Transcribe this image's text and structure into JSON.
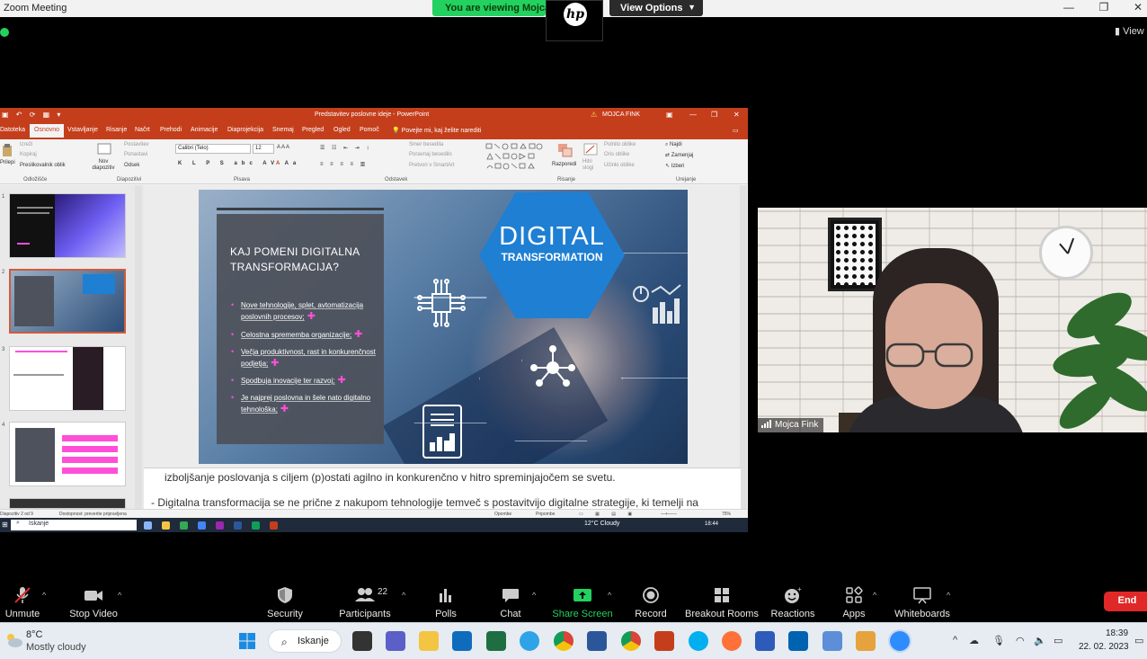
{
  "zoom": {
    "window_title": "Zoom Meeting",
    "viewing_banner": "You are viewing Mojca F",
    "view_options_label": "View Options",
    "view_label": "View",
    "window_controls": {
      "minimize": "—",
      "maximize": "❐",
      "close": "✕"
    }
  },
  "powerpoint": {
    "doc_title": "Predstavitev poslovne ideje  -  PowerPoint",
    "user_name": "MOJCA FINK",
    "tabs": [
      {
        "label": "Datoteka",
        "active": false
      },
      {
        "label": "Osnovno",
        "active": true
      },
      {
        "label": "Vstavljanje",
        "active": false
      },
      {
        "label": "Risanje",
        "active": false
      },
      {
        "label": "Načrt",
        "active": false
      },
      {
        "label": "Prehodi",
        "active": false
      },
      {
        "label": "Animacije",
        "active": false
      },
      {
        "label": "Diaprojekcija",
        "active": false
      },
      {
        "label": "Snemaj",
        "active": false
      },
      {
        "label": "Pregled",
        "active": false
      },
      {
        "label": "Ogled",
        "active": false
      },
      {
        "label": "Pomoč",
        "active": false
      }
    ],
    "tell_me": "Povejte mi, kaj želite narediti",
    "ribbon": {
      "paste": "Prilepi",
      "cut": "Izreži",
      "copy": "Kopiraj",
      "format_painter": "Preslikovalnik oblik",
      "clipboard_group": "Odložišče",
      "new_slide": "Nov diapozitiv",
      "layout": "Postavitev",
      "reset": "Ponastavi",
      "section": "Odsek",
      "slides_group": "Diapozitivi",
      "font_name": "Calibri (Telo)",
      "font_size": "12",
      "font_group": "Pisava",
      "paragraph_group": "Odstavek",
      "text_direction": "Smer besedila",
      "align_text": "Poravnaj besedilo",
      "smartart": "Pretvori v SmartArt",
      "arrange": "Razporedi",
      "quick_styles": "Hitri slogi",
      "shape_fill": "Polnilo oblike",
      "shape_outline": "Oris oblike",
      "shape_effects": "Učinki oblike",
      "drawing_group": "Risanje",
      "find": "Najdi",
      "replace": "Zamenjaj",
      "select": "Izberi",
      "editing_group": "Urejanje"
    },
    "slide": {
      "title": "KAJ POMENI DIGITALNA TRANSFORMACIJA?",
      "bullets": [
        "Nove tehnologije, splet, avtomatizacija poslovnih procesov;",
        "Celostna sprememba organizacije;",
        "Večja produktivnost, rast in konkurenčnost podjetja;",
        "Spodbuja inovacije ter razvoj;",
        "Je najprej poslovna in šele nato digitalno tehnološka;"
      ],
      "graphic_word_1": "DIGITAL",
      "graphic_word_2": "TRANSFORMATION"
    },
    "notes": [
      "izboljšanje poslovanja s ciljem (p)ostati agilno in konkurenčno v hitro spreminjajočem se svetu.",
      "-   Digitalna transformacija se ne prične z nakupom tehnologije temveč s postavitvijo digitalne strategije, ki temelji na"
    ],
    "status": {
      "slide_counter": "Diapozitiv 2 od 9",
      "accessibility": "Dostopnost: preverite pripravljena",
      "notes_btn": "Opombe",
      "comments_btn": "Pripombe",
      "zoom_pct": "75%"
    },
    "thumb_numbers": [
      "1",
      "2",
      "3",
      "4"
    ],
    "remote_taskbar": {
      "search": "Iskanje",
      "weather": "12°C  Cloudy",
      "time": "18:44"
    }
  },
  "participant": {
    "name": "Mojca Fink"
  },
  "toolbar": {
    "unmute": "Unmute",
    "stop_video": "Stop Video",
    "security": "Security",
    "participants": "Participants",
    "participants_count": "22",
    "polls": "Polls",
    "chat": "Chat",
    "share_screen": "Share Screen",
    "record": "Record",
    "breakout_rooms": "Breakout Rooms",
    "reactions": "Reactions",
    "apps": "Apps",
    "whiteboards": "Whiteboards",
    "end": "End"
  },
  "taskbar": {
    "temperature": "8°C",
    "weather": "Mostly cloudy",
    "search": "Iskanje",
    "time": "18:39",
    "date": "22. 02. 2023"
  },
  "colors": {
    "ppt_accent": "#c43e1c",
    "zoom_green": "#23d160",
    "end_red": "#e02828",
    "bullet_pink": "#ff4fd8"
  }
}
